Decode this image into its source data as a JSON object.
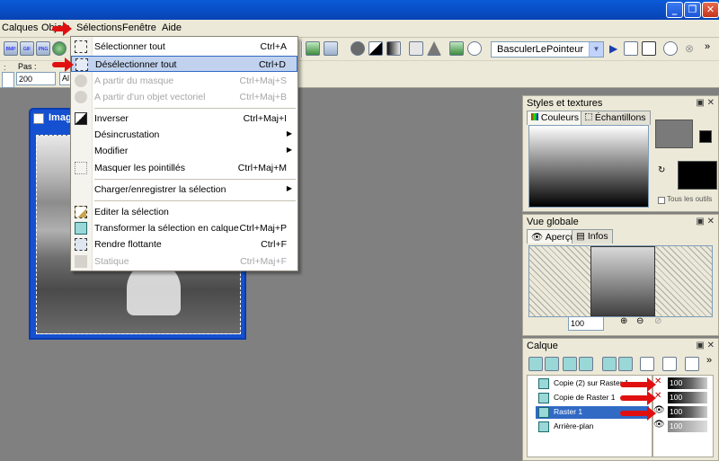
{
  "menubar": {
    "items": [
      "Calques",
      "Objets",
      "Sélections",
      "Fenêtre",
      "Aide"
    ]
  },
  "toolbar": {
    "pas_label": "Pas :",
    "size_value": "200",
    "mode_value": "Al",
    "pointer_combo": "BasculerLePointeur",
    "bitmap_badges": [
      "BMP",
      "GIF",
      "PNG"
    ]
  },
  "document": {
    "title": "Imag"
  },
  "selection_menu": {
    "items": [
      {
        "label": "Sélectionner tout",
        "shortcut": "Ctrl+A",
        "enabled": true,
        "icon": "select-all-icon"
      },
      {
        "label": "Désélectionner tout",
        "shortcut": "Ctrl+D",
        "enabled": true,
        "highlighted": true,
        "icon": "deselect-all-icon"
      },
      {
        "label": "A partir du masque",
        "shortcut": "Ctrl+Maj+S",
        "enabled": false,
        "icon": "from-mask-icon"
      },
      {
        "label": "A partir d'un objet vectoriel",
        "shortcut": "Ctrl+Maj+B",
        "enabled": false,
        "icon": "from-vector-icon"
      },
      {
        "label": "Inverser",
        "shortcut": "Ctrl+Maj+I",
        "enabled": true,
        "icon": "invert-icon"
      },
      {
        "label": "Désincrustation",
        "shortcut": "",
        "enabled": true,
        "submenu": true
      },
      {
        "label": "Modifier",
        "shortcut": "",
        "enabled": true,
        "submenu": true
      },
      {
        "label": "Masquer les pointillés",
        "shortcut": "Ctrl+Maj+M",
        "enabled": true,
        "icon": "hide-marquee-icon"
      },
      {
        "label": "Charger/enregistrer la sélection",
        "shortcut": "",
        "enabled": true,
        "submenu": true
      },
      {
        "label": "Editer la sélection",
        "shortcut": "",
        "enabled": true,
        "icon": "edit-selection-icon"
      },
      {
        "label": "Transformer la sélection en calque",
        "shortcut": "Ctrl+Maj+P",
        "enabled": true,
        "icon": "promote-layer-icon"
      },
      {
        "label": "Rendre flottante",
        "shortcut": "Ctrl+F",
        "enabled": true,
        "icon": "float-icon"
      },
      {
        "label": "Statique",
        "shortcut": "Ctrl+Maj+F",
        "enabled": false,
        "icon": "defloat-icon"
      }
    ]
  },
  "styles_panel": {
    "title": "Styles et textures",
    "tabs": [
      "Couleurs",
      "Échantillons"
    ],
    "all_tools_label": "Tous les outils"
  },
  "overview_panel": {
    "title": "Vue globale",
    "tabs": [
      "Aperçu",
      "Infos"
    ],
    "zoom": "100"
  },
  "layers_panel": {
    "title": "Calque",
    "layers": [
      {
        "name": "Copie (2) sur Raster 1",
        "opacity": "100"
      },
      {
        "name": "Copie de Raster 1",
        "opacity": "100"
      },
      {
        "name": "Raster 1",
        "opacity": "100",
        "selected": true
      },
      {
        "name": "Arrière-plan",
        "opacity": "100"
      }
    ]
  },
  "colors": {
    "menu_highlight": "#c1d2ee",
    "annotation_arrow": "#e01010",
    "selection_blue": "#316ac5"
  }
}
